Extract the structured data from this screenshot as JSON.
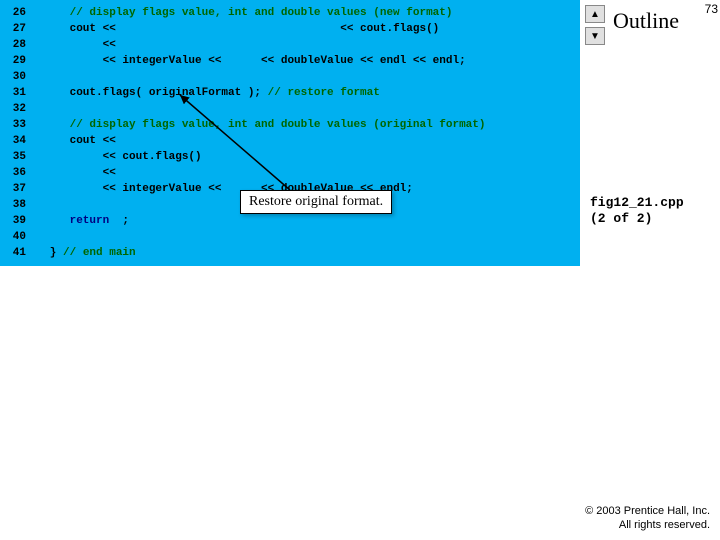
{
  "page_number": "73",
  "outline_title": "Outline",
  "fig_label_line1": "fig12_21.cpp",
  "fig_label_line2": "(2 of 2)",
  "callout_text": "Restore original format.",
  "copyright_line1": "© 2003 Prentice Hall, Inc.",
  "copyright_line2": "All rights reserved.",
  "nav": {
    "up": "▲",
    "down": "▼"
  },
  "code": {
    "l26": {
      "n": "26",
      "pre": "      ",
      "comment": "// display flags value, int and double values (new format)"
    },
    "l27": {
      "n": "27",
      "pre": "      cout << ",
      "tail": "                                 << cout.flags()"
    },
    "l28": {
      "n": "28",
      "pre": "           << "
    },
    "l29": {
      "n": "29",
      "pre": "           << integerValue << ",
      "tail": "     << doubleValue << endl << endl;"
    },
    "l30": {
      "n": "30"
    },
    "l31": {
      "n": "31",
      "pre": "      cout.flags( originalFormat ); ",
      "comment": "// restore format"
    },
    "l32": {
      "n": "32"
    },
    "l33": {
      "n": "33",
      "pre": "      ",
      "comment": "// display flags value, int and double values (original format)"
    },
    "l34": {
      "n": "34",
      "pre": "      cout << "
    },
    "l35": {
      "n": "35",
      "pre": "           << cout.flags()"
    },
    "l36": {
      "n": "36",
      "pre": "           << "
    },
    "l37": {
      "n": "37",
      "pre": "           << integerValue << ",
      "tail": "     << doubleValue << endl;"
    },
    "l38": {
      "n": "38"
    },
    "l39": {
      "n": "39",
      "pre": "      ",
      "kw": "return",
      "tail": "  ;"
    },
    "l40": {
      "n": "40"
    },
    "l41": {
      "n": "41",
      "pre": "   } ",
      "comment": "// end main"
    }
  }
}
